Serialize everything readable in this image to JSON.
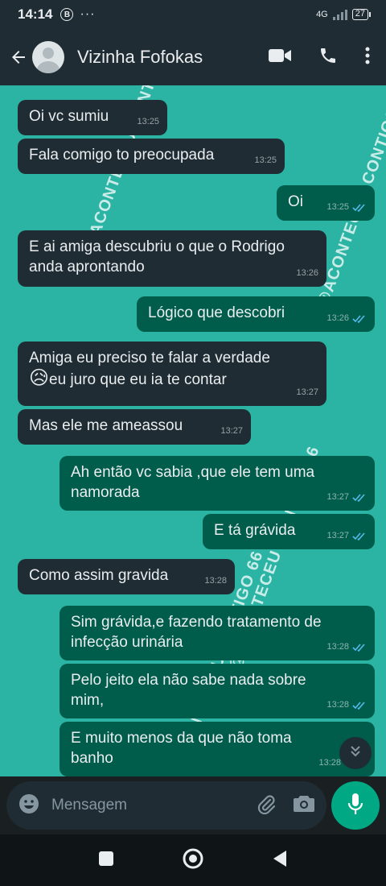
{
  "status": {
    "time": "14:14",
    "b_icon": "B",
    "dots": "···",
    "network": "4G",
    "battery": "27"
  },
  "header": {
    "contact_name": "Vizinha Fofokas"
  },
  "watermark_text": "IG:@ACONTECEU CONTIGO 66",
  "messages": [
    {
      "text": "Oi vc sumiu",
      "time": "13:25"
    },
    {
      "text": "Fala comigo to preocupada",
      "time": "13:25"
    },
    {
      "text": "Oi",
      "time": "13:25"
    },
    {
      "text1": "E ai amiga descubriu o que o Rodrigo",
      "text2": "anda aprontando",
      "time": "13:26"
    },
    {
      "text": "Lógico que descobri",
      "time": "13:26"
    },
    {
      "text1": "Amiga eu preciso te falar a verdade",
      "emoji": "😥",
      "text2": "eu juro que eu ia te contar",
      "time": "13:27"
    },
    {
      "text": "Mas ele me ameassou",
      "time": "13:27"
    },
    {
      "text1": "Ah então vc sabia ,que ele tem uma",
      "text2": "namorada",
      "time": "13:27"
    },
    {
      "text": "E tá grávida",
      "time": "13:27"
    },
    {
      "text": "Como assim gravida",
      "time": "13:28"
    },
    {
      "text1": "Sim grávida,e fazendo tratamento de",
      "text2": "infecção urinária",
      "time": "13:28"
    },
    {
      "text1": "Pelo jeito ela não sabe nada sobre",
      "text2": "mim,",
      "time": "13:28"
    },
    {
      "text1": "E muito menos da que não toma",
      "text2": "banho",
      "time": "13:28"
    }
  ],
  "input": {
    "placeholder": "Mensagem"
  },
  "icons": [
    "back-arrow-icon",
    "video-call-icon",
    "phone-icon",
    "more-vert-icon",
    "emoji-icon",
    "attach-icon",
    "camera-icon",
    "mic-icon",
    "chevron-double-down-icon",
    "square-nav-icon",
    "circle-nav-icon",
    "triangle-nav-icon"
  ]
}
